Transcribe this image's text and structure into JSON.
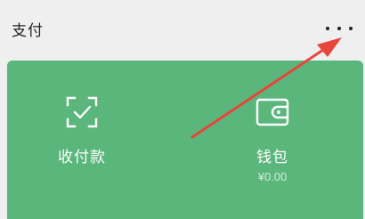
{
  "header": {
    "title": "支付"
  },
  "tiles": {
    "pay": {
      "label": "收付款"
    },
    "wallet": {
      "label": "钱包",
      "balance": "¥0.00"
    }
  },
  "colors": {
    "card": "#5ab67b",
    "annotation_arrow": "#e8463c"
  },
  "icons": {
    "more": "more-dots-icon",
    "pay": "scan-check-icon",
    "wallet": "wallet-icon"
  }
}
